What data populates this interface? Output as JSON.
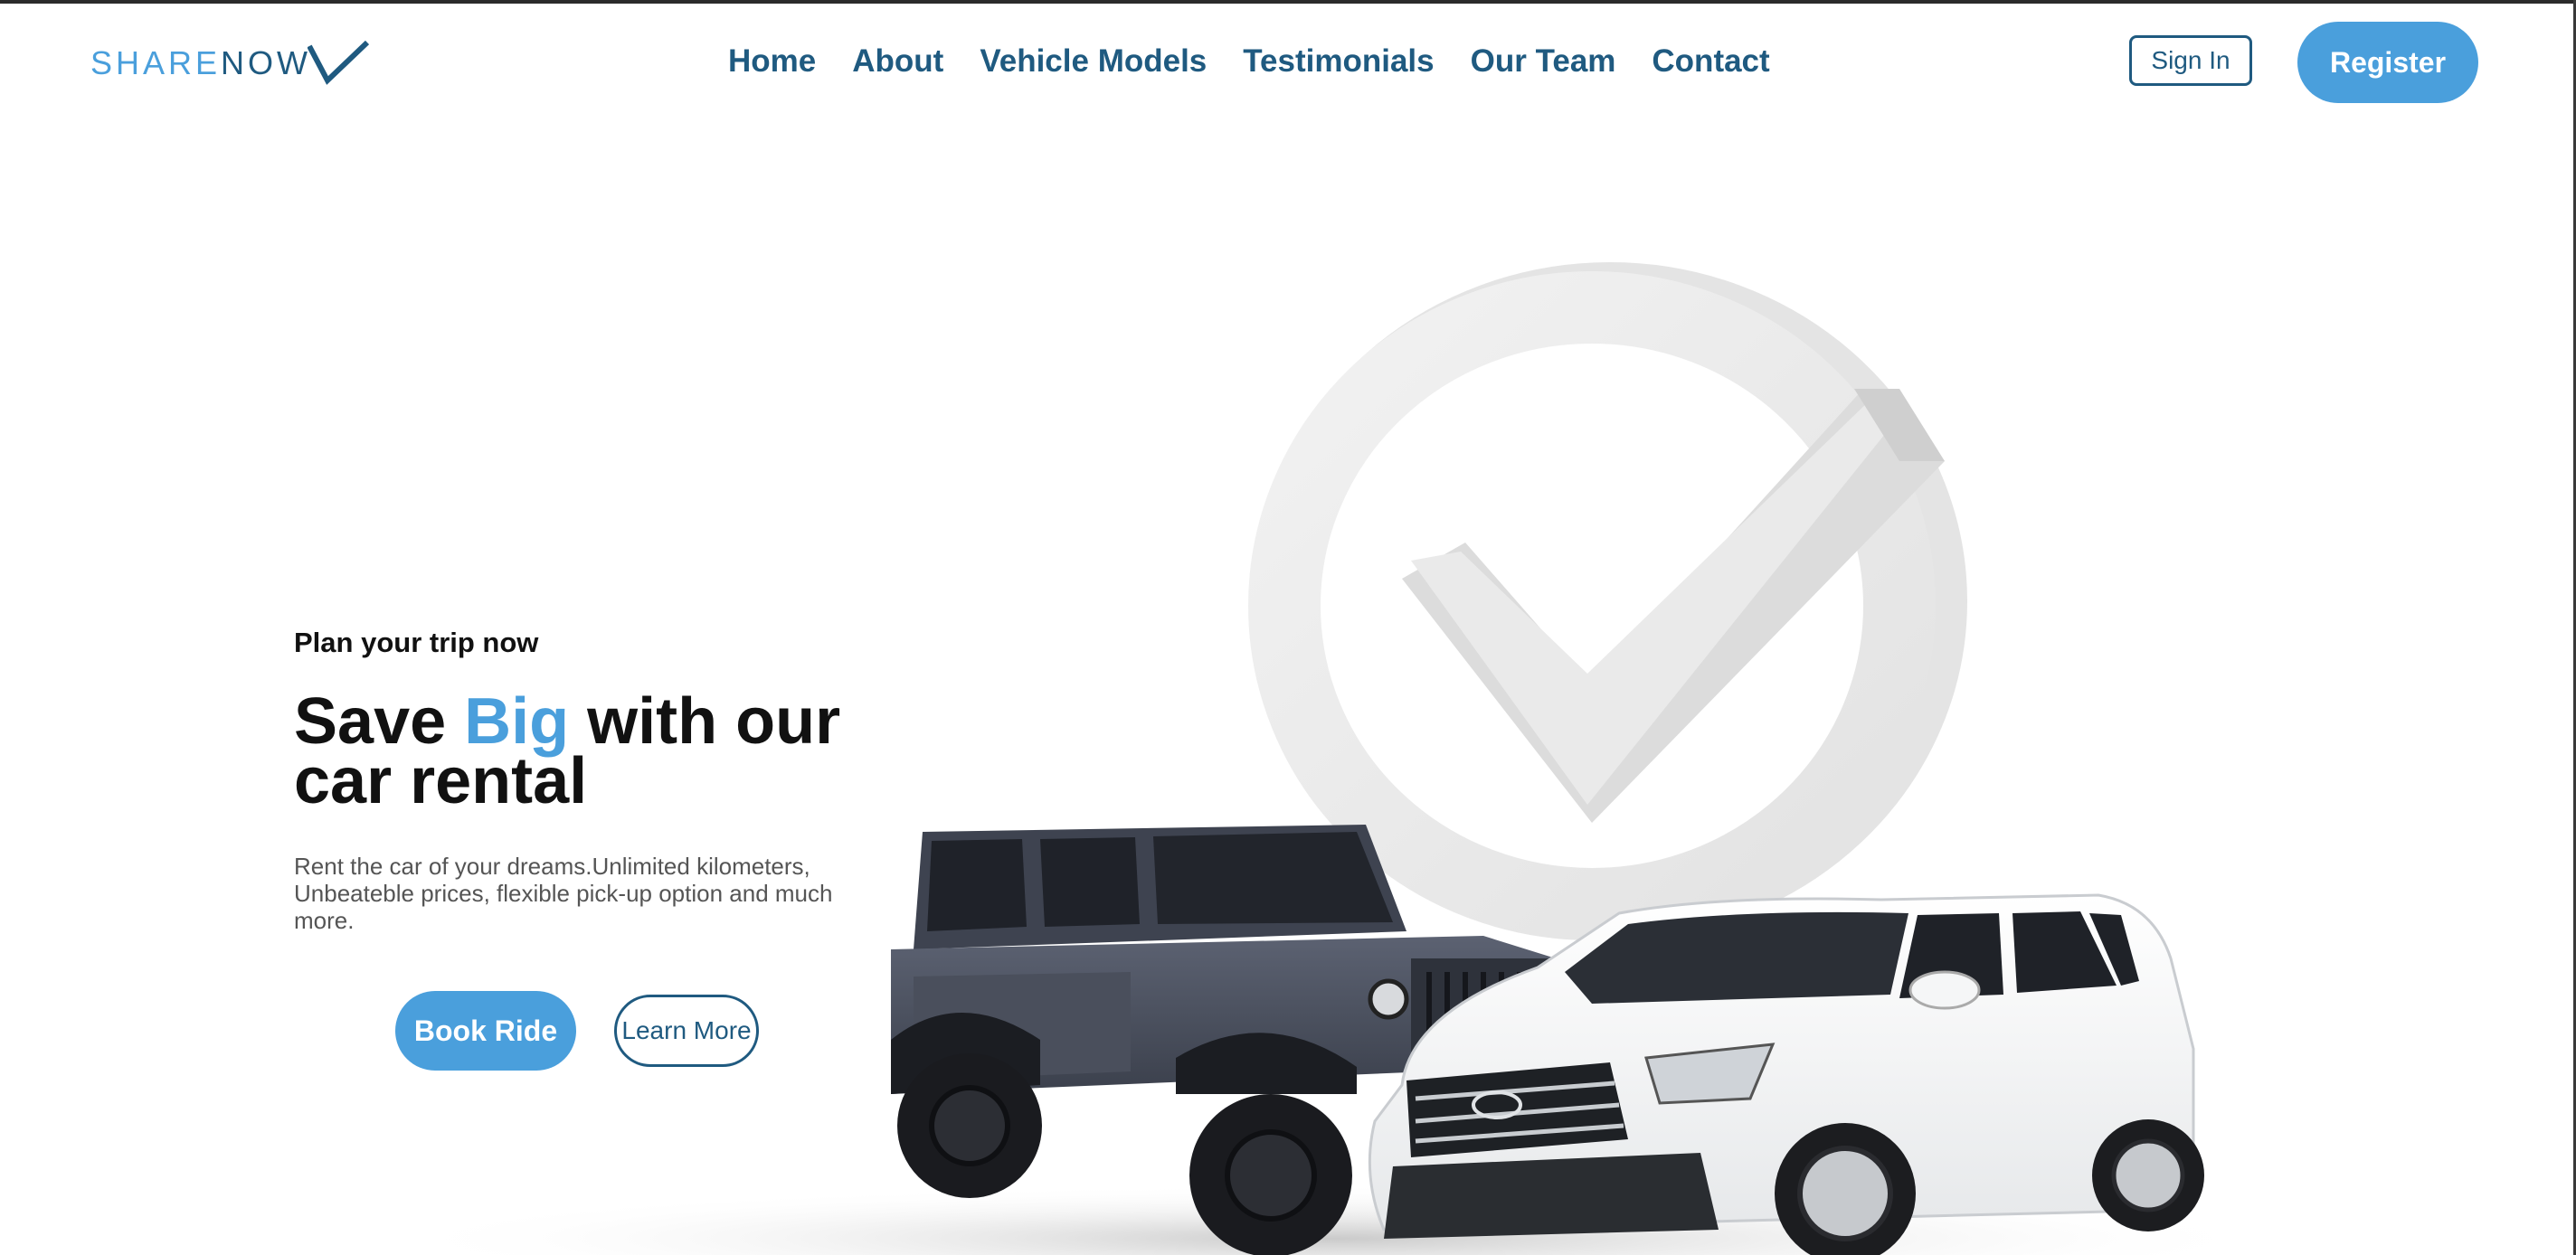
{
  "header": {
    "logo": {
      "part1": "SHARE",
      "part2": "NOW"
    },
    "nav": [
      {
        "label": "Home"
      },
      {
        "label": "About"
      },
      {
        "label": "Vehicle Models"
      },
      {
        "label": "Testimonials"
      },
      {
        "label": "Our Team"
      },
      {
        "label": "Contact"
      }
    ],
    "sign_in_label": "Sign In",
    "register_label": "Register"
  },
  "hero": {
    "eyebrow": "Plan your trip now",
    "headline_part1": "Save ",
    "headline_accent": "Big",
    "headline_part2": " with our car rental",
    "description": "Rent the car of your dreams.Unlimited kilometers, Unbeateble prices, flexible pick-up option and much more.",
    "book_label": "Book Ride",
    "learn_label": "Learn More"
  },
  "colors": {
    "brand_blue": "#4a9fdc",
    "brand_navy": "#1f5a80",
    "text_dark": "#111111"
  },
  "icons": [
    "logo-check-mark",
    "checkmark-badge",
    "jeep-car",
    "suv-car"
  ]
}
